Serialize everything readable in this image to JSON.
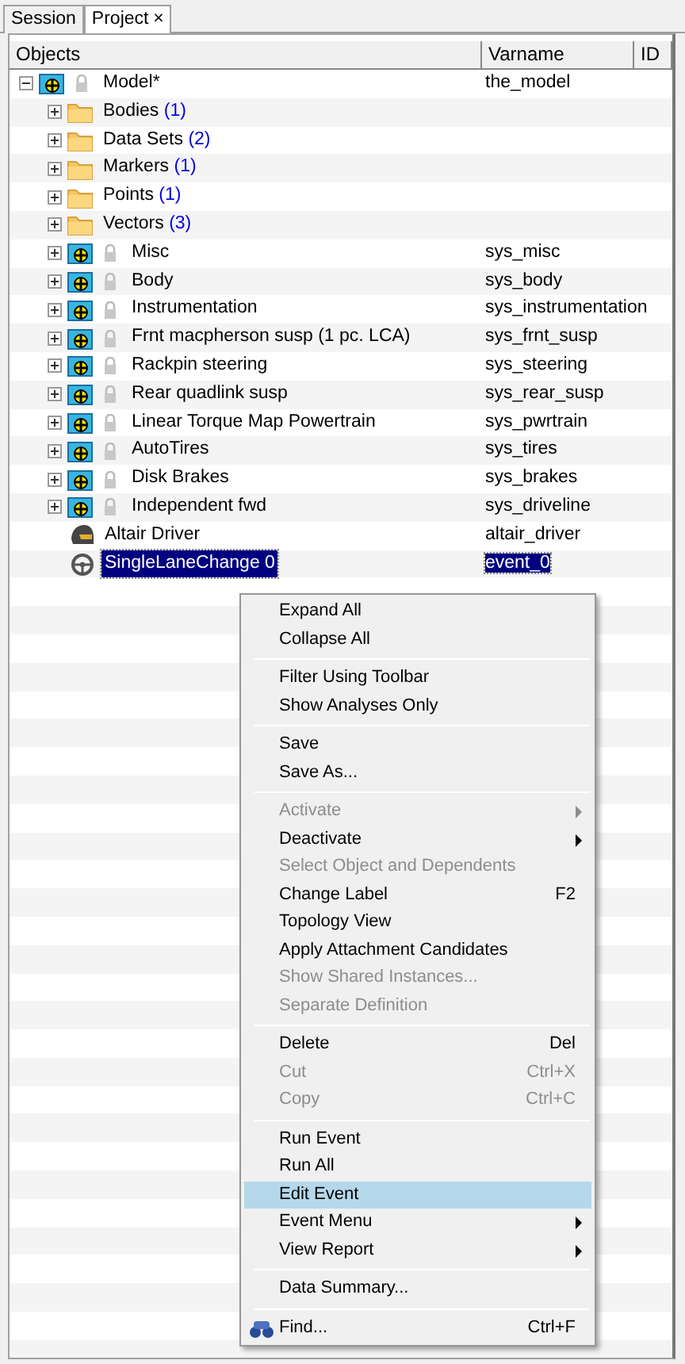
{
  "tabs": [
    {
      "label": "Session",
      "selected": false,
      "closable": false
    },
    {
      "label": "Project",
      "selected": true,
      "closable": true,
      "close_glyph": "×"
    }
  ],
  "table": {
    "columns": [
      "Objects",
      "Varname",
      "ID"
    ],
    "tree": [
      {
        "kind": "system",
        "label": "Model*",
        "varname": "the_model",
        "expanded": true,
        "selected": false,
        "children": [
          {
            "kind": "folder",
            "label": "Bodies",
            "count": "(1)",
            "expanded": false,
            "selected": false
          },
          {
            "kind": "folder",
            "label": "Data Sets",
            "count": "(2)",
            "expanded": false,
            "selected": false
          },
          {
            "kind": "folder",
            "label": "Markers",
            "count": "(1)",
            "expanded": false,
            "selected": false
          },
          {
            "kind": "folder",
            "label": "Points",
            "count": "(1)",
            "expanded": false,
            "selected": false
          },
          {
            "kind": "folder",
            "label": "Vectors",
            "count": "(3)",
            "expanded": false,
            "selected": false
          },
          {
            "kind": "system",
            "label": "Misc",
            "varname": "sys_misc",
            "expanded": false,
            "selected": false
          },
          {
            "kind": "system",
            "label": "Body",
            "varname": "sys_body",
            "expanded": false,
            "selected": false
          },
          {
            "kind": "system",
            "label": "Instrumentation",
            "varname": "sys_instrumentation",
            "expanded": false,
            "selected": false
          },
          {
            "kind": "system",
            "label": "Frnt macpherson susp (1 pc. LCA)",
            "varname": "sys_frnt_susp",
            "expanded": false,
            "selected": false
          },
          {
            "kind": "system",
            "label": "Rackpin steering",
            "varname": "sys_steering",
            "expanded": false,
            "selected": false
          },
          {
            "kind": "system",
            "label": "Rear quadlink susp",
            "varname": "sys_rear_susp",
            "expanded": false,
            "selected": false
          },
          {
            "kind": "system",
            "label": "Linear Torque Map Powertrain",
            "varname": "sys_pwrtrain",
            "expanded": false,
            "selected": false
          },
          {
            "kind": "system",
            "label": "AutoTires",
            "varname": "sys_tires",
            "expanded": false,
            "selected": false
          },
          {
            "kind": "system",
            "label": "Disk Brakes",
            "varname": "sys_brakes",
            "expanded": false,
            "selected": false
          },
          {
            "kind": "system",
            "label": "Independent fwd",
            "varname": "sys_driveline",
            "expanded": false,
            "selected": false
          },
          {
            "kind": "driver",
            "label": "Altair Driver",
            "varname": "altair_driver",
            "selected": false
          },
          {
            "kind": "event",
            "label": "SingleLaneChange 0",
            "varname": "event_0",
            "selected": true
          }
        ]
      }
    ]
  },
  "context_menu": [
    {
      "kind": "item",
      "label": "Expand All",
      "disabled": false,
      "selected": false
    },
    {
      "kind": "item",
      "label": "Collapse All",
      "disabled": false,
      "selected": false
    },
    {
      "kind": "separator"
    },
    {
      "kind": "item",
      "label": "Filter Using Toolbar",
      "disabled": false,
      "selected": false
    },
    {
      "kind": "item",
      "label": "Show Analyses Only",
      "disabled": false,
      "selected": false
    },
    {
      "kind": "separator"
    },
    {
      "kind": "item",
      "label": "Save",
      "disabled": false,
      "selected": false
    },
    {
      "kind": "item",
      "label": "Save As...",
      "disabled": false,
      "selected": false
    },
    {
      "kind": "separator"
    },
    {
      "kind": "item",
      "label": "Activate",
      "disabled": true,
      "submenu": true,
      "selected": false
    },
    {
      "kind": "item",
      "label": "Deactivate",
      "disabled": false,
      "submenu": true,
      "selected": false
    },
    {
      "kind": "item",
      "label": "Select Object and Dependents",
      "disabled": true,
      "selected": false
    },
    {
      "kind": "item",
      "label": "Change Label",
      "shortcut": "F2",
      "disabled": false,
      "selected": false
    },
    {
      "kind": "item",
      "label": "Topology View",
      "disabled": false,
      "selected": false
    },
    {
      "kind": "item",
      "label": "Apply Attachment Candidates",
      "disabled": false,
      "selected": false
    },
    {
      "kind": "item",
      "label": "Show Shared Instances...",
      "disabled": true,
      "selected": false
    },
    {
      "kind": "item",
      "label": "Separate Definition",
      "disabled": true,
      "selected": false
    },
    {
      "kind": "separator"
    },
    {
      "kind": "item",
      "label": "Delete",
      "shortcut": "Del",
      "disabled": false,
      "selected": false
    },
    {
      "kind": "item",
      "label": "Cut",
      "shortcut": "Ctrl+X",
      "disabled": true,
      "selected": false
    },
    {
      "kind": "item",
      "label": "Copy",
      "shortcut": "Ctrl+C",
      "disabled": true,
      "selected": false
    },
    {
      "kind": "separator"
    },
    {
      "kind": "item",
      "label": "Run Event",
      "disabled": false,
      "selected": false
    },
    {
      "kind": "item",
      "label": "Run All",
      "disabled": false,
      "selected": false
    },
    {
      "kind": "item",
      "label": "Edit Event",
      "disabled": false,
      "selected": true
    },
    {
      "kind": "item",
      "label": "Event Menu",
      "disabled": false,
      "submenu": true,
      "selected": false
    },
    {
      "kind": "item",
      "label": "View Report",
      "disabled": false,
      "submenu": true,
      "selected": false
    },
    {
      "kind": "separator"
    },
    {
      "kind": "item",
      "label": "Data Summary...",
      "disabled": false,
      "selected": false
    },
    {
      "kind": "separator"
    },
    {
      "kind": "find",
      "label": "Find...",
      "shortcut": "Ctrl+F",
      "disabled": false,
      "selected": false
    }
  ]
}
